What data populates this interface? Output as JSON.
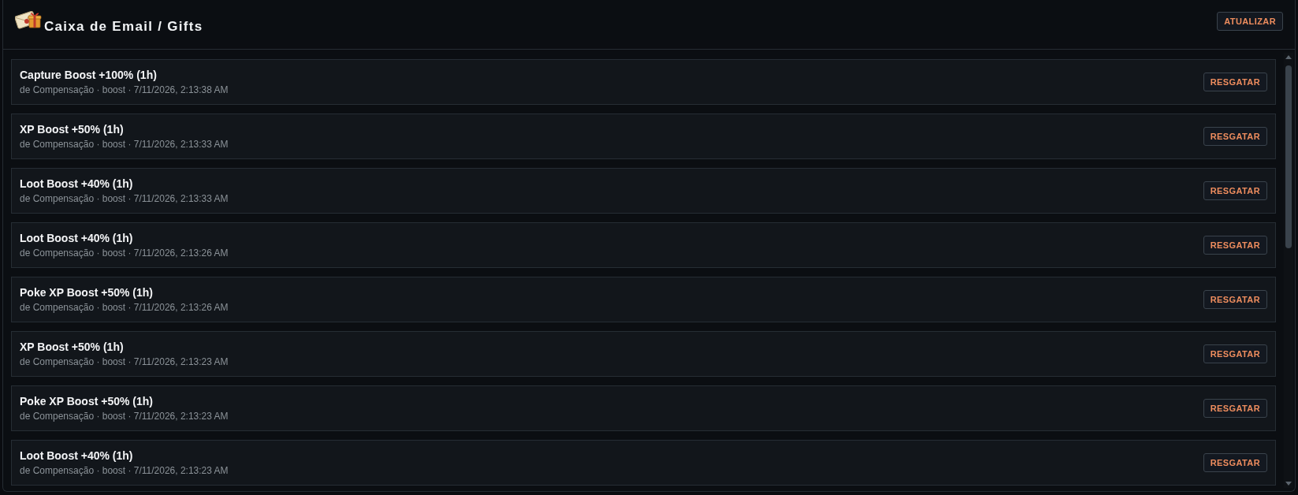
{
  "window": {
    "title": "Caixa de Email / Gifts",
    "refresh_button": "ATUALIZAR"
  },
  "gifts": [
    {
      "title": "Capture Boost +100% (1h)",
      "meta": "de Compensação · boost · 7/11/2026, 2:13:38 AM",
      "button": "RESGATAR"
    },
    {
      "title": "XP Boost +50% (1h)",
      "meta": "de Compensação · boost · 7/11/2026, 2:13:33 AM",
      "button": "RESGATAR"
    },
    {
      "title": "Loot Boost +40% (1h)",
      "meta": "de Compensação · boost · 7/11/2026, 2:13:33 AM",
      "button": "RESGATAR"
    },
    {
      "title": "Loot Boost +40% (1h)",
      "meta": "de Compensação · boost · 7/11/2026, 2:13:26 AM",
      "button": "RESGATAR"
    },
    {
      "title": "Poke XP Boost +50% (1h)",
      "meta": "de Compensação · boost · 7/11/2026, 2:13:26 AM",
      "button": "RESGATAR"
    },
    {
      "title": "XP Boost +50% (1h)",
      "meta": "de Compensação · boost · 7/11/2026, 2:13:23 AM",
      "button": "RESGATAR"
    },
    {
      "title": "Poke XP Boost +50% (1h)",
      "meta": "de Compensação · boost · 7/11/2026, 2:13:23 AM",
      "button": "RESGATAR"
    },
    {
      "title": "Loot Boost +40% (1h)",
      "meta": "de Compensação · boost · 7/11/2026, 2:13:23 AM",
      "button": "RESGATAR"
    }
  ]
}
